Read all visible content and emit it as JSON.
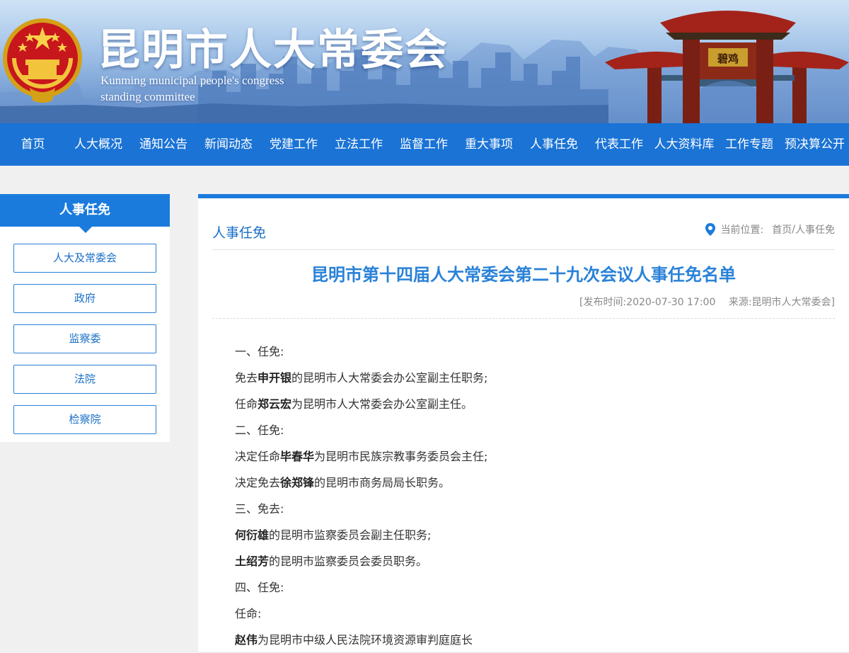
{
  "header": {
    "title": "昆明市人大常委会",
    "subtitle_line1": "Kunming municipal people's congress",
    "subtitle_line2": "standing committee",
    "archway_plaque": "碧鸡"
  },
  "nav": {
    "items": [
      "首页",
      "人大概况",
      "通知公告",
      "新闻动态",
      "党建工作",
      "立法工作",
      "监督工作",
      "重大事项",
      "人事任免",
      "代表工作",
      "人大资料库",
      "工作专题",
      "预决算公开"
    ]
  },
  "sidebar": {
    "title": "人事任免",
    "items": [
      "人大及常委会",
      "政府",
      "监察委",
      "法院",
      "检察院"
    ]
  },
  "content": {
    "section_title": "人事任免",
    "breadcrumb_label": "当前位置:",
    "breadcrumb_home": "首页",
    "breadcrumb_sep": "/",
    "breadcrumb_current": "人事任免",
    "article_title": "昆明市第十四届人大常委会第二十九次会议人事任免名单",
    "meta": "[发布时间:2020-07-30 17:00　 来源:昆明市人大常委会]",
    "paragraphs": [
      {
        "pre": "一、任免:",
        "name": "",
        "post": ""
      },
      {
        "pre": "免去",
        "name": "申开银",
        "post": "的昆明市人大常委会办公室副主任职务;"
      },
      {
        "pre": "任命",
        "name": "郑云宏",
        "post": "为昆明市人大常委会办公室副主任。"
      },
      {
        "pre": "二、任免:",
        "name": "",
        "post": ""
      },
      {
        "pre": "决定任命",
        "name": "毕春华",
        "post": "为昆明市民族宗教事务委员会主任;"
      },
      {
        "pre": "决定免去",
        "name": "徐郑锋",
        "post": "的昆明市商务局局长职务。"
      },
      {
        "pre": "三、免去:",
        "name": "",
        "post": ""
      },
      {
        "pre": "",
        "name": "何衍雄",
        "post": "的昆明市监察委员会副主任职务;"
      },
      {
        "pre": "",
        "name": "土绍芳",
        "post": "的昆明市监察委员会委员职务。"
      },
      {
        "pre": "四、任免:",
        "name": "",
        "post": ""
      },
      {
        "pre": "任命:",
        "name": "",
        "post": ""
      },
      {
        "pre": "",
        "name": "赵伟",
        "post": "为昆明市中级人民法院环境资源审判庭庭长"
      }
    ]
  },
  "colors": {
    "nav_blue": "#1a73d5",
    "accent_blue": "#1a7bdc",
    "title_blue": "#2a82d8",
    "page_bg": "#f0f0f0"
  },
  "icons": {
    "emblem": "national-emblem",
    "location": "location-pin-icon"
  }
}
